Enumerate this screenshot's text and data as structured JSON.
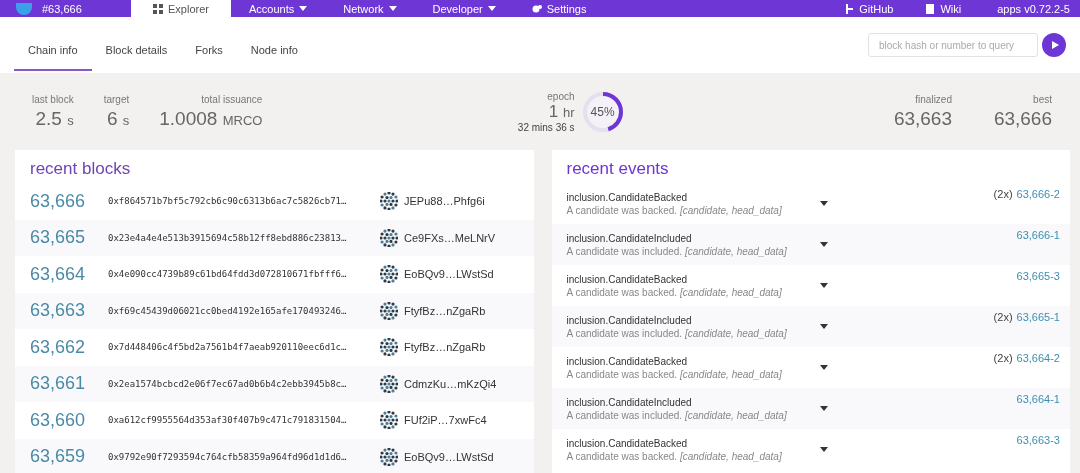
{
  "top_bar": {
    "block_number": "#63,666",
    "menu": [
      {
        "label": "Explorer",
        "kind": "grid",
        "selected": true
      },
      {
        "label": "Accounts",
        "kind": "dropdown",
        "selected": false
      },
      {
        "label": "Network",
        "kind": "dropdown",
        "selected": false
      },
      {
        "label": "Developer",
        "kind": "dropdown",
        "selected": false
      },
      {
        "label": "Settings",
        "kind": "gear",
        "selected": false
      }
    ],
    "links": [
      {
        "label": "GitHub",
        "kind": "branch"
      },
      {
        "label": "Wiki",
        "kind": "book"
      }
    ],
    "version": "apps v0.72.2-5"
  },
  "tabs": [
    {
      "label": "Chain info",
      "selected": true
    },
    {
      "label": "Block details",
      "selected": false
    },
    {
      "label": "Forks",
      "selected": false
    },
    {
      "label": "Node info",
      "selected": false
    }
  ],
  "search": {
    "placeholder": "block hash or number to query"
  },
  "stats_left": [
    {
      "label": "last block",
      "value": "2.5",
      "unit": "s"
    },
    {
      "label": "target",
      "value": "6",
      "unit": "s"
    },
    {
      "label": "total issuance",
      "value": "1.0008",
      "unit": "MRCO"
    }
  ],
  "epoch": {
    "label": "epoch",
    "value": "1",
    "unit": "hr",
    "remaining": "32 mins 36 s",
    "percent": "45%",
    "level": 0.45
  },
  "stats_right": [
    {
      "label": "finalized",
      "value": "63,663"
    },
    {
      "label": "best",
      "value": "63,666"
    }
  ],
  "recent_blocks": {
    "title": "recent blocks",
    "rows": [
      {
        "number": "63,666",
        "hash": "0xf864571b7bf5c792cb6c90c6313b6ac7c5826cb71…",
        "author": "JEPu88…Phfg6i"
      },
      {
        "number": "63,665",
        "hash": "0x23e4a4e4e513b3915694c58b12ff8ebd886c23813…",
        "author": "Ce9FXs…MeLNrV"
      },
      {
        "number": "63,664",
        "hash": "0x4e090cc4739b89c61bd64fdd3d072810671fbfff6…",
        "author": "EoBQv9…LWstSd"
      },
      {
        "number": "63,663",
        "hash": "0xf69c45439d06021cc0bed4192e165afe170493246…",
        "author": "FtyfBz…nZgaRb"
      },
      {
        "number": "63,662",
        "hash": "0x7d448406c4f5bd2a7561b4f7aeab920110eec6d1c…",
        "author": "FtyfBz…nZgaRb"
      },
      {
        "number": "63,661",
        "hash": "0x2ea1574bcbcd2e06f7ec67ad0b6b4c2ebb3945b8c…",
        "author": "CdmzKu…mKzQi4"
      },
      {
        "number": "63,660",
        "hash": "0xa612cf9955564d353af30f407b9c471c791831504…",
        "author": "FUf2iP…7xwFc4"
      },
      {
        "number": "63,659",
        "hash": "0x9792e90f7293594c764cfb58359a964fd96d1d1d6…",
        "author": "EoBQv9…LWstSd"
      }
    ]
  },
  "recent_events": {
    "title": "recent events",
    "rows": [
      {
        "name": "inclusion.CandidateBacked",
        "description": "A candidate was backed. *[candidate, head_data]*",
        "count": "(2x)",
        "ref": "63,666-2"
      },
      {
        "name": "inclusion.CandidateIncluded",
        "description": "A candidate was included. *[candidate, head_data]*",
        "ref": "63,666-1"
      },
      {
        "name": "inclusion.CandidateBacked",
        "description": "A candidate was backed. *[candidate, head_data]*",
        "ref": "63,665-3"
      },
      {
        "name": "inclusion.CandidateIncluded",
        "description": "A candidate was included. *[candidate, head_data]*",
        "count": "(2x)",
        "ref": "63,665-1"
      },
      {
        "name": "inclusion.CandidateBacked",
        "description": "A candidate was backed. *[candidate, head_data]*",
        "count": "(2x)",
        "ref": "63,664-2"
      },
      {
        "name": "inclusion.CandidateIncluded",
        "description": "A candidate was included. *[candidate, head_data]*",
        "ref": "63,664-1"
      },
      {
        "name": "inclusion.CandidateBacked",
        "description": "A candidate was backed. *[candidate, head_data]*",
        "ref": "63,663-3"
      }
    ]
  }
}
